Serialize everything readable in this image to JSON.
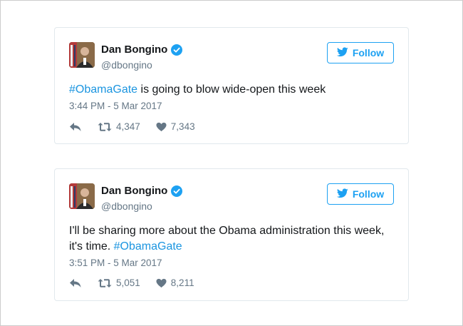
{
  "tweets": [
    {
      "name": "Dan Bongino",
      "handle": "@dbongino",
      "follow_label": "Follow",
      "hashtag": "#ObamaGate",
      "text_after": " is going to blow wide-open this week",
      "timestamp": "3:44 PM - 5 Mar 2017",
      "retweets": "4,347",
      "likes": "7,343"
    },
    {
      "name": "Dan Bongino",
      "handle": "@dbongino",
      "follow_label": "Follow",
      "text_line1": "I'll be sharing more about the Obama administration this week,",
      "text_line2": "it's time. ",
      "hashtag": "#ObamaGate",
      "timestamp": "3:51 PM - 5 Mar 2017",
      "retweets": "5,051",
      "likes": "8,211"
    }
  ],
  "colors": {
    "accent": "#1da1f2",
    "hashtag": "#1b95e0",
    "muted": "#657786"
  },
  "icons": [
    "avatar",
    "verified-badge-icon",
    "twitter-bird-icon",
    "reply-icon",
    "retweet-icon",
    "heart-icon"
  ]
}
